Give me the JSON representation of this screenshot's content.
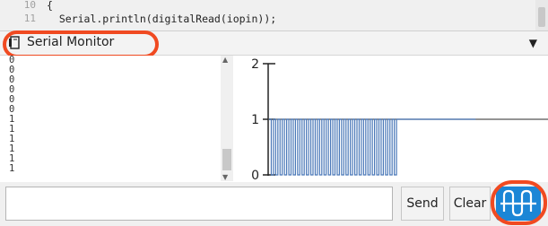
{
  "code": {
    "lines": [
      {
        "num": "10",
        "text": "{"
      },
      {
        "num": "11",
        "text": "  Serial.println(digitalRead(iopin));"
      }
    ]
  },
  "monitor": {
    "title": "Serial Monitor",
    "icon": "serial-monitor-icon",
    "dropdown_icon": "dropdown-arrow-icon"
  },
  "output": {
    "lines": [
      "0",
      "0",
      "0",
      "0",
      "0",
      "0",
      "1",
      "1",
      "1",
      "1",
      "1",
      "1"
    ]
  },
  "chart_data": {
    "type": "line",
    "title": "",
    "xlabel": "",
    "ylabel": "",
    "yticks": [
      "2",
      "1",
      "0"
    ],
    "ylim": [
      0,
      2
    ],
    "baseline": 1,
    "series": [
      {
        "values": [
          1,
          0,
          1,
          0,
          1,
          0,
          1,
          0,
          1,
          0,
          1,
          0,
          1,
          0,
          1,
          0,
          1,
          0,
          1,
          0,
          1,
          0,
          1,
          0,
          1,
          0,
          1,
          0,
          1,
          0,
          1,
          0,
          1,
          0,
          1,
          0,
          1,
          0,
          1,
          0,
          1,
          0,
          1,
          0,
          1,
          0,
          1,
          0,
          1,
          0,
          1,
          0,
          1,
          0,
          1,
          0,
          1,
          0,
          1,
          1,
          1,
          1,
          1,
          1,
          1,
          1,
          1,
          1,
          1,
          1,
          1,
          1,
          1,
          1,
          1,
          1,
          1,
          1,
          1,
          1,
          1,
          1,
          1,
          1,
          1,
          1,
          1,
          1,
          1,
          1,
          1,
          1,
          1,
          1
        ]
      }
    ],
    "colors": {
      "signal": "#4a78b8",
      "baseline": "#555555",
      "axis": "#222222"
    }
  },
  "input": {
    "value": "",
    "placeholder": ""
  },
  "buttons": {
    "send": "Send",
    "clear": "Clear",
    "plot_icon": "waveform-plot-icon"
  },
  "colors": {
    "accent": "#1b86d6",
    "highlight": "#f04a21"
  }
}
